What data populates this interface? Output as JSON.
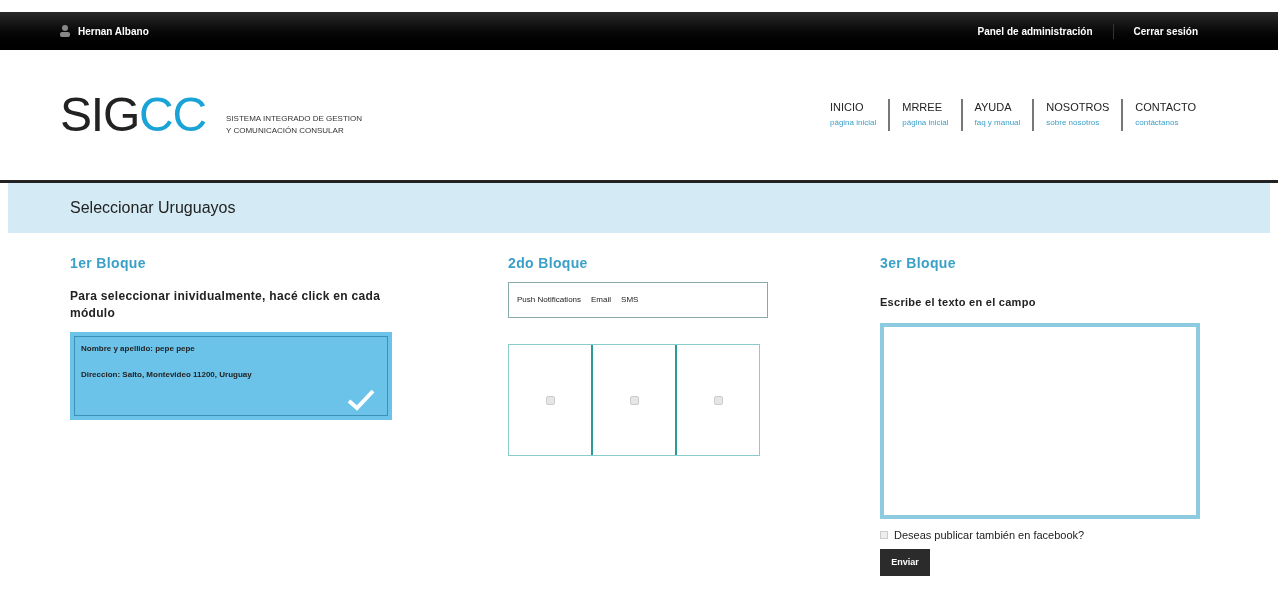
{
  "top_bar": {
    "user": "Hernan Albano",
    "links": [
      "Panel de administración",
      "Cerrar sesión"
    ]
  },
  "logo": {
    "main": "SIG",
    "accent": "CC",
    "tagline": [
      "SISTEMA INTEGRADO DE GESTION",
      "Y COMUNICACIÓN CONSULAR"
    ]
  },
  "nav": [
    {
      "label": "INICIO",
      "sub": "página inicial"
    },
    {
      "label": "MRREE",
      "sub": "página inicial"
    },
    {
      "label": "AYUDA",
      "sub": "faq y manual"
    },
    {
      "label": "NOSOTROS",
      "sub": "sobre nosotros"
    },
    {
      "label": "CONTACTO",
      "sub": "contáctanos"
    }
  ],
  "page_title": "Seleccionar Uruguayos",
  "block1": {
    "title": "1er Bloque",
    "instruction": "Para seleccionar inividualmente, hacé click en cada módulo",
    "cards": [
      {
        "name_line": "Nombre y apellido: pepe pepe",
        "address_line": "Direccion: Salto, Montevideo 11200, Uruguay",
        "selected": true
      }
    ]
  },
  "block2": {
    "title": "2do Bloque",
    "tabs": [
      "Push Notifications",
      "Email",
      "SMS"
    ],
    "options": [
      {
        "checked": false
      },
      {
        "checked": false
      },
      {
        "checked": false
      }
    ]
  },
  "block3": {
    "title": "3er Bloque",
    "label": "Escribe el texto en el campo",
    "facebook": {
      "label": "Deseas publicar también en facebook?",
      "checked": false
    },
    "button": "Enviar"
  }
}
